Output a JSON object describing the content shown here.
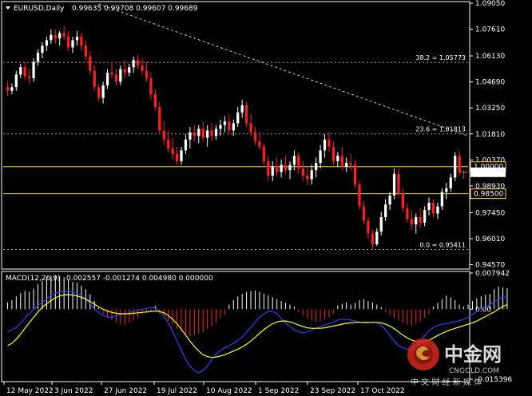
{
  "header": {
    "symbol": "EURUSD,Daily",
    "ohlc": "0.99635 0.99708 0.99607 0.99689"
  },
  "macd_header": {
    "label": "MACD(12,26,9)",
    "values": "0.002557 -0.001274 0.004980 0.000000"
  },
  "colors": {
    "background": "#000000",
    "axis": "#ffffff",
    "bull_candle": "#ffffff",
    "bear_candle": "#ff1e1e",
    "level_line": "#ffd21e",
    "macd_signal": "#ffff00",
    "macd_line": "#2244ff",
    "fib_line": "#cccccc"
  },
  "watermark": {
    "brand": "中金网",
    "url": "CNGOLD.COM",
    "slogan": "中 文 财 经 新 媒 体"
  },
  "chart_data": [
    {
      "type": "candlestick",
      "title": "EURUSD,Daily",
      "ylim": [
        0.9446,
        1.0905
      ],
      "y_ticks": [
        "1.09050",
        "1.07610",
        "1.06130",
        "1.04690",
        "1.03250",
        "1.01810",
        "1.00370",
        "0.98930",
        "0.97450",
        "0.96010",
        "0.94570"
      ],
      "x_ticks": [
        "12 May 2022",
        "3 Jun 2022",
        "27 Jun 2022",
        "19 Jul 2022",
        "10 Aug 2022",
        "1 Sep 2022",
        "23 Sep 2022",
        "17 Oct 2022"
      ],
      "candles": [
        [
          1.044,
          1.047,
          1.039,
          1.042
        ],
        [
          1.042,
          1.046,
          1.04,
          1.044
        ],
        [
          1.044,
          1.053,
          1.042,
          1.051
        ],
        [
          1.051,
          1.057,
          1.049,
          1.055
        ],
        [
          1.055,
          1.058,
          1.048,
          1.05
        ],
        [
          1.05,
          1.054,
          1.046,
          1.049
        ],
        [
          1.049,
          1.06,
          1.047,
          1.058
        ],
        [
          1.058,
          1.065,
          1.056,
          1.063
        ],
        [
          1.063,
          1.069,
          1.06,
          1.067
        ],
        [
          1.067,
          1.072,
          1.064,
          1.07
        ],
        [
          1.07,
          1.076,
          1.068,
          1.073
        ],
        [
          1.073,
          1.076,
          1.068,
          1.071
        ],
        [
          1.071,
          1.075,
          1.067,
          1.074
        ],
        [
          1.074,
          1.078,
          1.07,
          1.072
        ],
        [
          1.072,
          1.075,
          1.064,
          1.066
        ],
        [
          1.066,
          1.072,
          1.063,
          1.07
        ],
        [
          1.07,
          1.075,
          1.067,
          1.072
        ],
        [
          1.072,
          1.074,
          1.064,
          1.067
        ],
        [
          1.067,
          1.07,
          1.059,
          1.061
        ],
        [
          1.061,
          1.064,
          1.051,
          1.053
        ],
        [
          1.053,
          1.056,
          1.042,
          1.044
        ],
        [
          1.044,
          1.046,
          1.036,
          1.038
        ],
        [
          1.038,
          1.047,
          1.035,
          1.045
        ],
        [
          1.045,
          1.054,
          1.043,
          1.052
        ],
        [
          1.052,
          1.058,
          1.049,
          1.051
        ],
        [
          1.051,
          1.054,
          1.045,
          1.047
        ],
        [
          1.047,
          1.056,
          1.045,
          1.054
        ],
        [
          1.054,
          1.059,
          1.049,
          1.052
        ],
        [
          1.052,
          1.057,
          1.05,
          1.055
        ],
        [
          1.055,
          1.061,
          1.052,
          1.059
        ],
        [
          1.059,
          1.062,
          1.054,
          1.056
        ],
        [
          1.056,
          1.06,
          1.051,
          1.053
        ],
        [
          1.053,
          1.058,
          1.047,
          1.049
        ],
        [
          1.049,
          1.052,
          1.037,
          1.04
        ],
        [
          1.04,
          1.043,
          1.031,
          1.033
        ],
        [
          1.033,
          1.036,
          1.018,
          1.02
        ],
        [
          1.02,
          1.025,
          1.012,
          1.015
        ],
        [
          1.015,
          1.02,
          1.008,
          1.01
        ],
        [
          1.01,
          1.016,
          1.004,
          1.007
        ],
        [
          1.007,
          1.011,
          1.001,
          1.003
        ],
        [
          1.003,
          1.011,
          1.001,
          1.009
        ],
        [
          1.009,
          1.018,
          1.007,
          1.015
        ],
        [
          1.015,
          1.022,
          1.01,
          1.019
        ],
        [
          1.019,
          1.023,
          1.014,
          1.017
        ],
        [
          1.017,
          1.023,
          1.013,
          1.021
        ],
        [
          1.021,
          1.025,
          1.014,
          1.016
        ],
        [
          1.016,
          1.023,
          1.011,
          1.02
        ],
        [
          1.02,
          1.024,
          1.014,
          1.017
        ],
        [
          1.017,
          1.023,
          1.015,
          1.021
        ],
        [
          1.021,
          1.026,
          1.017,
          1.023
        ],
        [
          1.023,
          1.028,
          1.019,
          1.025
        ],
        [
          1.025,
          1.029,
          1.018,
          1.02
        ],
        [
          1.02,
          1.026,
          1.017,
          1.024
        ],
        [
          1.024,
          1.033,
          1.022,
          1.03
        ],
        [
          1.03,
          1.037,
          1.027,
          1.034
        ],
        [
          1.034,
          1.036,
          1.022,
          1.024
        ],
        [
          1.024,
          1.029,
          1.017,
          1.019
        ],
        [
          1.019,
          1.022,
          1.012,
          1.014
        ],
        [
          1.014,
          1.019,
          1.009,
          1.011
        ],
        [
          1.011,
          1.013,
          1.001,
          1.003
        ],
        [
          1.003,
          1.006,
          0.992,
          0.995
        ],
        [
          0.995,
          1.003,
          0.992,
          1.0
        ],
        [
          1.0,
          1.005,
          0.995,
          0.997
        ],
        [
          0.997,
          1.004,
          0.994,
          1.001
        ],
        [
          1.001,
          1.006,
          0.996,
          0.998
        ],
        [
          0.998,
          1.003,
          0.993,
          1.001
        ],
        [
          1.001,
          1.009,
          0.998,
          1.006
        ],
        [
          1.006,
          1.008,
          0.996,
          0.999
        ],
        [
          0.999,
          1.003,
          0.992,
          0.995
        ],
        [
          0.995,
          0.999,
          0.99,
          0.993
        ],
        [
          0.993,
          1.001,
          0.99,
          0.998
        ],
        [
          0.998,
          1.005,
          0.994,
          1.002
        ],
        [
          1.002,
          1.012,
          0.999,
          1.009
        ],
        [
          1.009,
          1.018,
          1.005,
          1.015
        ],
        [
          1.015,
          1.019,
          1.008,
          1.011
        ],
        [
          1.011,
          1.014,
          1.001,
          1.003
        ],
        [
          1.003,
          1.008,
          1.0,
          1.006
        ],
        [
          1.006,
          1.011,
          0.998,
          1.0
        ],
        [
          1.0,
          1.005,
          0.997,
          1.002
        ],
        [
          1.002,
          1.007,
          0.998,
          1.001
        ],
        [
          1.001,
          1.004,
          0.988,
          0.99
        ],
        [
          0.99,
          0.992,
          0.976,
          0.978
        ],
        [
          0.978,
          0.981,
          0.968,
          0.97
        ],
        [
          0.97,
          0.972,
          0.96,
          0.963
        ],
        [
          0.963,
          0.965,
          0.9541,
          0.957
        ],
        [
          0.957,
          0.966,
          0.956,
          0.964
        ],
        [
          0.964,
          0.975,
          0.962,
          0.972
        ],
        [
          0.972,
          0.982,
          0.97,
          0.979
        ],
        [
          0.979,
          0.986,
          0.976,
          0.984
        ],
        [
          0.984,
          0.999,
          0.982,
          0.996
        ],
        [
          0.996,
          0.999,
          0.983,
          0.985
        ],
        [
          0.985,
          0.988,
          0.975,
          0.977
        ],
        [
          0.977,
          0.98,
          0.969,
          0.971
        ],
        [
          0.971,
          0.976,
          0.965,
          0.968
        ],
        [
          0.968,
          0.974,
          0.963,
          0.972
        ],
        [
          0.972,
          0.977,
          0.966,
          0.969
        ],
        [
          0.969,
          0.978,
          0.967,
          0.976
        ],
        [
          0.976,
          0.983,
          0.973,
          0.98
        ],
        [
          0.98,
          0.982,
          0.972,
          0.974
        ],
        [
          0.974,
          0.98,
          0.971,
          0.978
        ],
        [
          0.978,
          0.988,
          0.976,
          0.986
        ],
        [
          0.986,
          0.991,
          0.982,
          0.988
        ],
        [
          0.988,
          0.996,
          0.986,
          0.994
        ],
        [
          0.994,
          1.008,
          0.992,
          1.006
        ],
        [
          1.006,
          1.009,
          0.995,
          0.997
        ],
        [
          0.997,
          0.998,
          0.993,
          0.9969
        ]
      ],
      "levels": [
        {
          "value": 1.0,
          "label": "1.00000",
          "label_style": "box"
        },
        {
          "value": 0.985,
          "label": "0.98500",
          "label_style": "box"
        }
      ],
      "current_price": {
        "value": 0.99689,
        "label": "0.99689"
      },
      "fibonacci": [
        {
          "value": 1.05773,
          "label": "38.2 = 1.05773"
        },
        {
          "value": 1.01813,
          "label": "23.6 = 1.01813"
        },
        {
          "value": 0.95411,
          "label": "0.0 = 0.95411"
        }
      ],
      "trendline": {
        "from": {
          "candle": 21,
          "price": 1.09
        },
        "to": {
          "candle": 120,
          "price": 1.017
        }
      },
      "grid": false
    },
    {
      "type": "macd",
      "title": "MACD(12,26,9)",
      "ylim": [
        -0.01539,
        0.00794
      ],
      "y_ticks": [
        "0.007942",
        "0.00",
        "-0.015396"
      ],
      "histogram": [
        0.0015,
        0.002,
        0.0028,
        0.0035,
        0.004,
        0.0038,
        0.0045,
        0.0055,
        0.0062,
        0.007,
        0.0074,
        0.0073,
        0.0072,
        0.007,
        0.0064,
        0.006,
        0.0058,
        0.0052,
        0.0044,
        0.0033,
        0.0018,
        0.0003,
        -0.001,
        -0.0018,
        -0.0024,
        -0.0029,
        -0.0033,
        -0.0036,
        -0.003,
        -0.0025,
        -0.0018,
        -0.0012,
        -0.0008,
        -0.0004,
        0.0008,
        -0.001,
        -0.0018,
        -0.0026,
        -0.0034,
        -0.0042,
        -0.005,
        -0.0056,
        -0.006,
        -0.0057,
        -0.0053,
        -0.005,
        -0.0044,
        -0.0038,
        -0.003,
        -0.002,
        -0.0012,
        0.001,
        0.002,
        0.0028,
        0.0034,
        0.0038,
        0.004,
        0.0041,
        0.0038,
        0.0034,
        0.003,
        0.0026,
        0.0022,
        0.0018,
        0.0014,
        0.001,
        0.0006,
        -0.0006,
        -0.0014,
        -0.002,
        -0.0025,
        -0.0028,
        -0.0026,
        -0.0022,
        -0.0018,
        -0.001,
        0.0008,
        0.0012,
        0.0015,
        0.001,
        0.0014,
        0.002,
        0.0022,
        0.0018,
        0.0015,
        0.001,
        0.0005,
        -0.0006,
        -0.0014,
        -0.002,
        -0.0025,
        -0.003,
        -0.0034,
        -0.0036,
        -0.0032,
        -0.0028,
        -0.002,
        -0.0012,
        0.0006,
        0.0014,
        0.0022,
        0.003,
        0.0026,
        0.002,
        0.001,
        0.0006,
        0.001,
        0.0018,
        0.0024,
        0.0028,
        0.0032,
        0.0034,
        0.0044,
        0.005,
        0.0048,
        0.0046
      ],
      "macd_line": [
        -0.005,
        -0.0045,
        -0.004,
        -0.003,
        -0.002,
        -0.001,
        0.0,
        0.0008,
        0.0015,
        0.0022,
        0.003,
        0.0035,
        0.0038,
        0.004,
        0.004,
        0.0038,
        0.0035,
        0.003,
        0.0022,
        0.0012,
        0.0,
        -0.0008,
        -0.0014,
        -0.0017,
        -0.0018,
        -0.0015,
        -0.0012,
        -0.001,
        -0.0008,
        -0.0005,
        -0.0002,
        0.0,
        0.0002,
        0.0004,
        0.0003,
        -0.0005,
        -0.0015,
        -0.003,
        -0.0048,
        -0.007,
        -0.009,
        -0.011,
        -0.0125,
        -0.0135,
        -0.014,
        -0.0135,
        -0.0125,
        -0.011,
        -0.01,
        -0.009,
        -0.0085,
        -0.008,
        -0.0075,
        -0.0068,
        -0.0062,
        -0.005,
        -0.004,
        -0.0028,
        -0.0018,
        -0.001,
        -0.0005,
        -0.0005,
        -0.001,
        -0.002,
        -0.003,
        -0.0038,
        -0.0045,
        -0.005,
        -0.0052,
        -0.005,
        -0.0046,
        -0.0042,
        -0.0038,
        -0.0035,
        -0.0032,
        -0.0028,
        -0.0024,
        -0.0022,
        -0.0022,
        -0.0024,
        -0.0026,
        -0.0028,
        -0.003,
        -0.003,
        -0.0028,
        -0.003,
        -0.0035,
        -0.0045,
        -0.0058,
        -0.007,
        -0.008,
        -0.0085,
        -0.0088,
        -0.0088,
        -0.008,
        -0.007,
        -0.0058,
        -0.0048,
        -0.004,
        -0.0036,
        -0.0033,
        -0.0032,
        -0.003,
        -0.0028,
        -0.0025,
        -0.0022,
        -0.0018,
        -0.0012,
        -0.0005,
        0.0002,
        0.0006,
        0.001,
        0.0016,
        0.0022,
        0.0026,
        0.0026
      ],
      "signal_line": [
        -0.008,
        -0.0075,
        -0.0066,
        -0.0055,
        -0.0042,
        -0.003,
        -0.0018,
        -0.0006,
        0.0004,
        0.0012,
        0.0019,
        0.0025,
        0.0029,
        0.0031,
        0.0032,
        0.0031,
        0.0029,
        0.0026,
        0.0022,
        0.0017,
        0.0011,
        0.0005,
        0.0,
        -0.0004,
        -0.0007,
        -0.0009,
        -0.001,
        -0.001,
        -0.001,
        -0.0009,
        -0.0008,
        -0.0007,
        -0.0006,
        -0.0005,
        -0.0004,
        -0.0005,
        -0.0008,
        -0.0014,
        -0.0022,
        -0.0032,
        -0.0044,
        -0.0057,
        -0.007,
        -0.0082,
        -0.0092,
        -0.01,
        -0.0104,
        -0.0106,
        -0.0105,
        -0.0103,
        -0.01,
        -0.0096,
        -0.0092,
        -0.0088,
        -0.0083,
        -0.0077,
        -0.007,
        -0.0062,
        -0.0053,
        -0.0045,
        -0.0038,
        -0.0032,
        -0.0028,
        -0.0026,
        -0.0026,
        -0.0028,
        -0.0031,
        -0.0035,
        -0.0038,
        -0.0041,
        -0.0042,
        -0.0042,
        -0.0042,
        -0.0041,
        -0.0039,
        -0.0037,
        -0.0035,
        -0.0033,
        -0.0031,
        -0.003,
        -0.0029,
        -0.0029,
        -0.0029,
        -0.0029,
        -0.0029,
        -0.0029,
        -0.003,
        -0.0033,
        -0.0037,
        -0.0043,
        -0.005,
        -0.0057,
        -0.0063,
        -0.0068,
        -0.0071,
        -0.0072,
        -0.0071,
        -0.0068,
        -0.0063,
        -0.0058,
        -0.0053,
        -0.0049,
        -0.0045,
        -0.0042,
        -0.0039,
        -0.0036,
        -0.0033,
        -0.003,
        -0.0026,
        -0.0021,
        -0.0016,
        -0.0011,
        -0.0006,
        0.0,
        0.0006,
        0.001
      ]
    }
  ]
}
